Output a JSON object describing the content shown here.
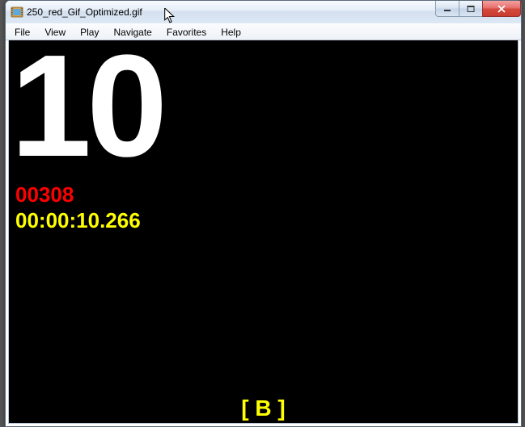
{
  "window": {
    "title": "250_red_Gif_Optimized.gif"
  },
  "menu": {
    "items": [
      "File",
      "View",
      "Play",
      "Navigate",
      "Favorites",
      "Help"
    ]
  },
  "content": {
    "big_number": "10",
    "frame_counter": "00308",
    "timecode": "00:00:10.266",
    "bottom_marker": "[ B ]"
  }
}
